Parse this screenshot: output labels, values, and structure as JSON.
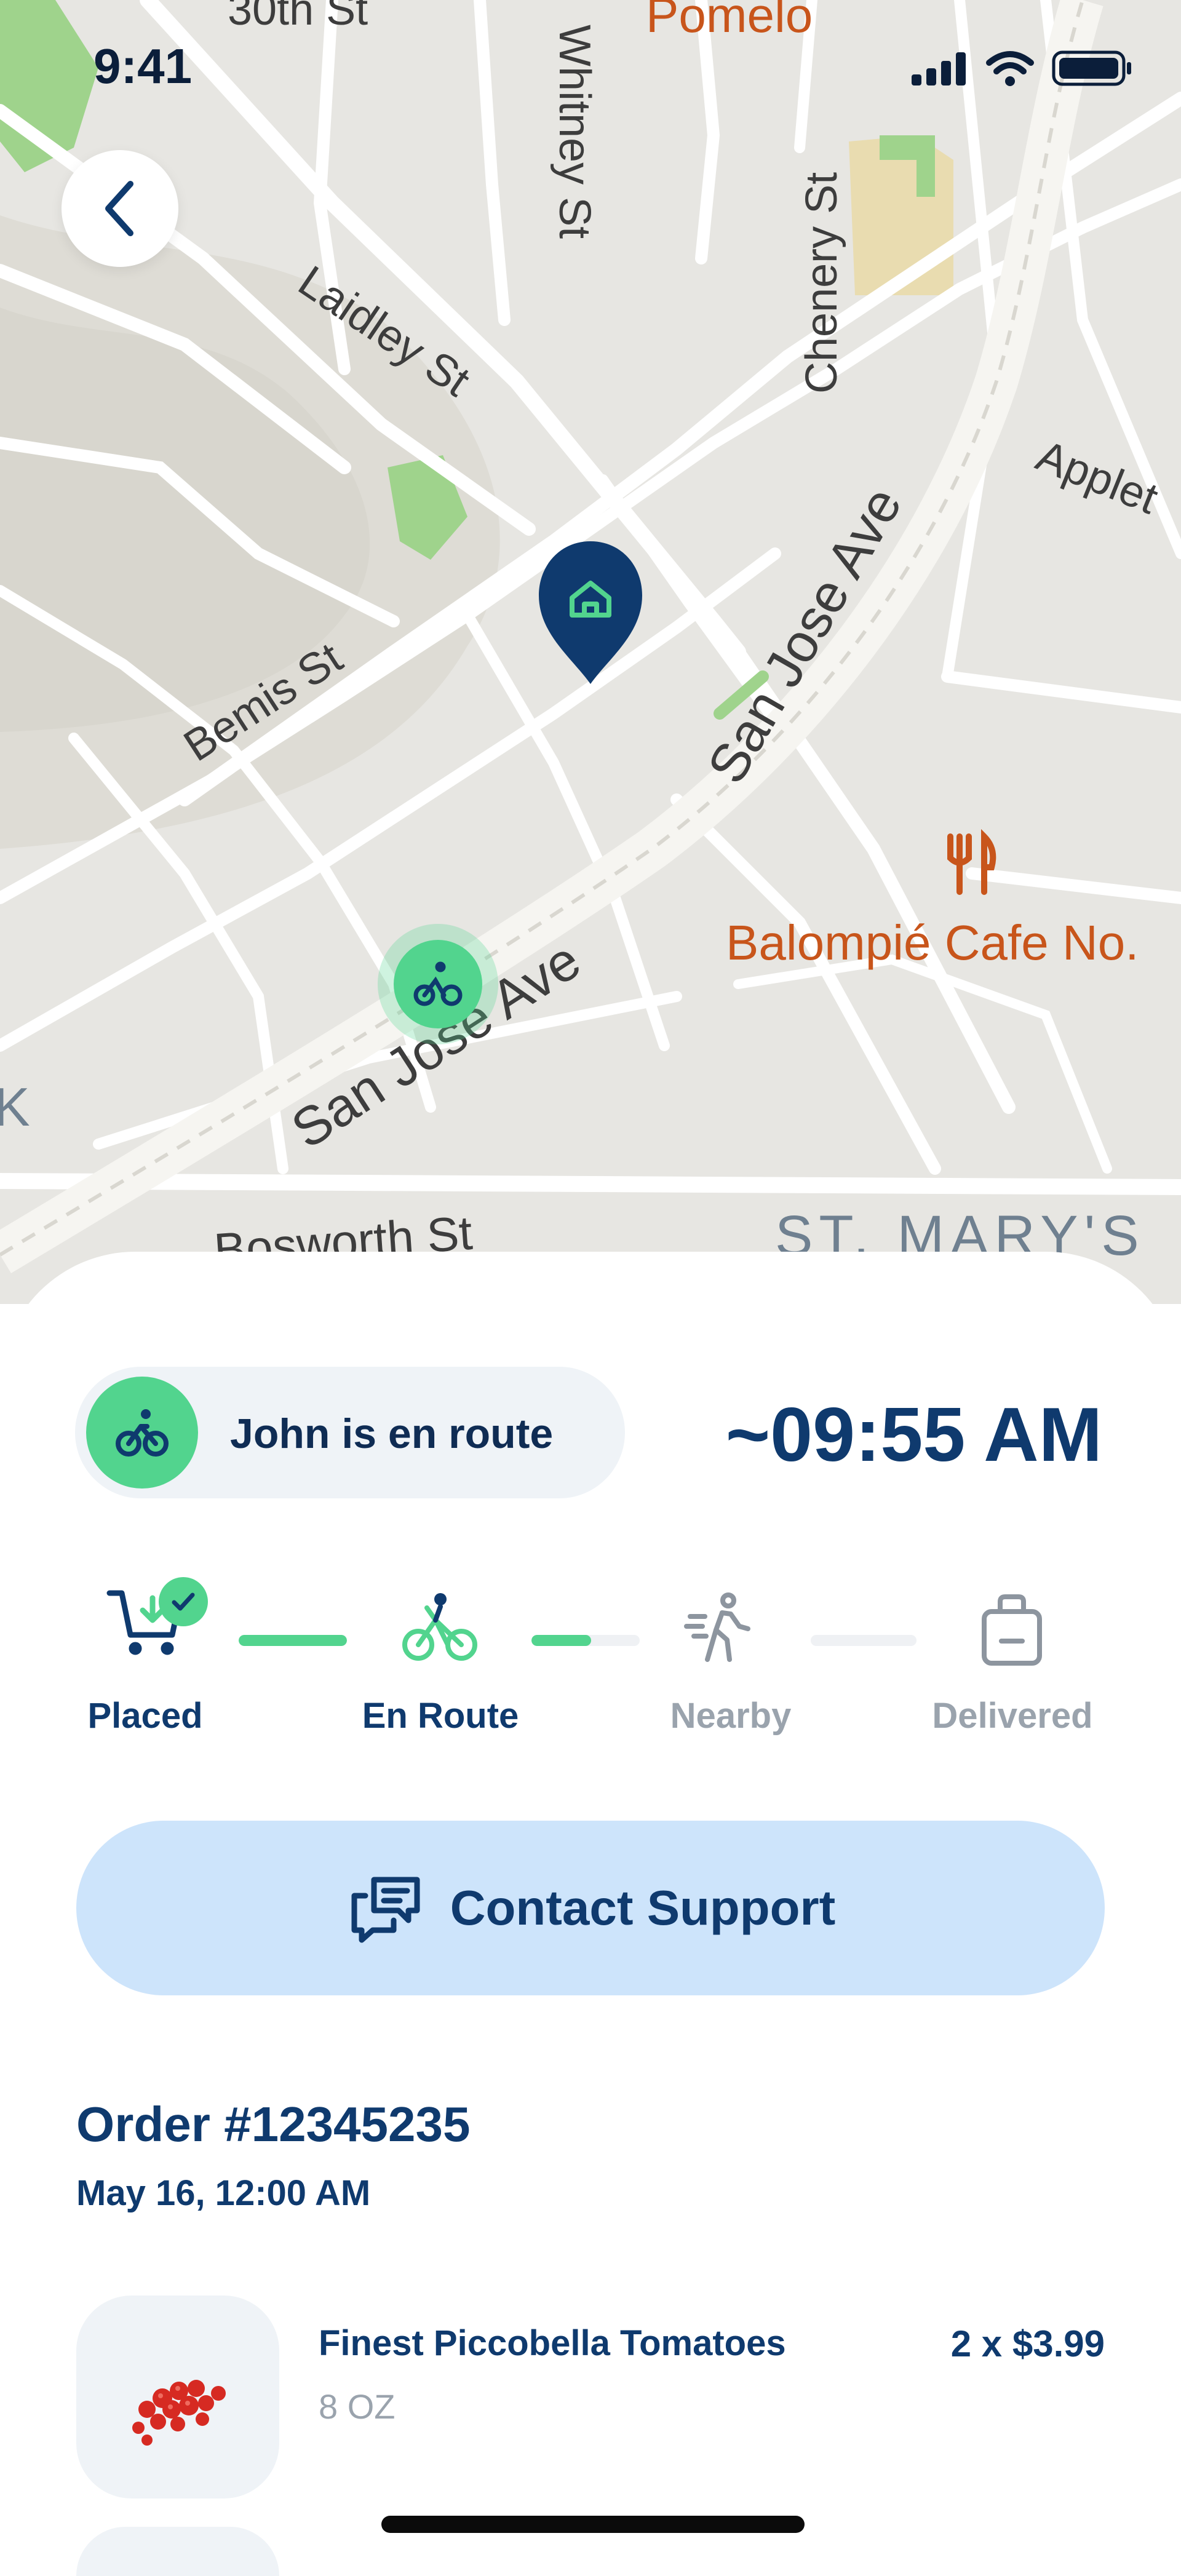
{
  "status_bar": {
    "time": "9:41"
  },
  "map": {
    "streets": [
      "30th St",
      "Whitney St",
      "Chenery St",
      "Laidley St",
      "Applet",
      "Bemis St",
      "San Jose Ave",
      "San Jose Ave",
      "Bosworth St"
    ],
    "places": [
      "Pomelo",
      "Balompié Cafe No.",
      "ST. MARY'S",
      "K"
    ],
    "pins": {
      "destination": "home-icon",
      "courier": "bicycle-icon"
    }
  },
  "tracking": {
    "courier_status": "John is en route",
    "eta": "~09:55 AM",
    "steps": [
      {
        "label": "Placed",
        "state": "done"
      },
      {
        "label": "En Route",
        "state": "active"
      },
      {
        "label": "Nearby",
        "state": "pending"
      },
      {
        "label": "Delivered",
        "state": "pending"
      }
    ],
    "progress": [
      1.0,
      0.55,
      0.0
    ]
  },
  "actions": {
    "contact_support": "Contact Support"
  },
  "order": {
    "title": "Order #12345235",
    "date": "May 16, 12:00 AM",
    "items": [
      {
        "name": "Finest Piccobella Tomatoes",
        "size": "8 OZ",
        "price": "2 x $3.99"
      }
    ]
  },
  "colors": {
    "primary": "#0f3a6e",
    "accent_green": "#52d48e",
    "support_bg": "#cde4fb",
    "muted": "#9aa3ad",
    "poi_orange": "#c8551b"
  }
}
